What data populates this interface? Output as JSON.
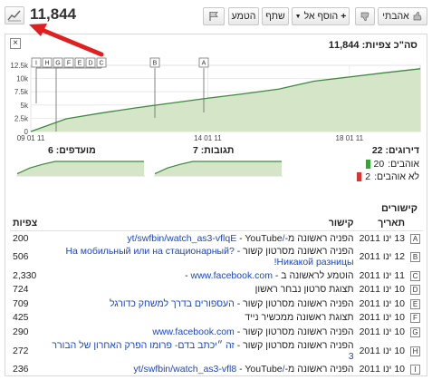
{
  "header": {
    "view_count": "11,844",
    "like_label": "אהבתי",
    "add_to_label": "הוסף אל",
    "share_label": "שתף",
    "embed_label": "הטמע"
  },
  "stats": {
    "total_views_label": "סה\"כ צפיות:",
    "total_views_value": "11,844",
    "ratings_label": "דירוגים:",
    "ratings_value": "22",
    "comments_label": "תגובות:",
    "comments_value": "7",
    "favorites_label": "מועדפים:",
    "favorites_value": "6",
    "likes_label": "אוהבים:",
    "likes_value": "20",
    "dislikes_label": "לא אוהבים:",
    "dislikes_value": "2"
  },
  "chart_data": {
    "type": "area",
    "x_tick_labels": [
      "09 01 11",
      "14 01 11",
      "18 01 11"
    ],
    "y_tick_labels": [
      "0",
      "2.5k",
      "5k",
      "7.5k",
      "10k",
      "12.5k"
    ],
    "ylim": [
      0,
      12500
    ],
    "x": [
      0,
      1,
      2,
      3,
      4,
      5,
      6,
      7,
      8,
      9,
      10,
      11
    ],
    "values": [
      0,
      2400,
      3500,
      4500,
      5400,
      6300,
      7100,
      8000,
      9500,
      10300,
      11100,
      11844
    ],
    "annotations": [
      "I",
      "H",
      "G",
      "F",
      "E",
      "D",
      "C",
      "B",
      "A"
    ],
    "grid": true,
    "colors": {
      "fill": "#d5e5c8",
      "line": "#3d8a3d"
    }
  },
  "mini_chart_values": [
    0.15,
    0.55,
    0.8,
    1.0,
    1.0,
    1.0,
    1.0,
    1.0,
    1.0,
    1.0,
    1.0
  ],
  "links_section": {
    "title": "קישורים",
    "col_date": "תאריך",
    "col_link": "קישור",
    "col_views": "צפיות",
    "rows": [
      {
        "letter": "A",
        "date": "13 ינו 2011",
        "desc": "הפניה ראשונה מ-",
        "url": "/yt/swfbin/watch_as3-vflqE",
        "suffix": " - YouTube",
        "views": "200"
      },
      {
        "letter": "B",
        "date": "12 ינו 2011",
        "desc": "הפניה ראשונה מסרטון קשור - ",
        "url": "На мобильный или на стационарный? Никакой разницы!",
        "suffix": "",
        "views": "506"
      },
      {
        "letter": "C",
        "date": "11 ינו 2011",
        "desc": "הוטמע לראשונה ב - ",
        "url": "www.facebook.com",
        "suffix": " - ",
        "views": "2,330"
      },
      {
        "letter": "D",
        "date": "10 ינו 2011",
        "desc": "תצוגת סרטון נבחר ראשון",
        "url": "",
        "suffix": "",
        "views": "724"
      },
      {
        "letter": "E",
        "date": "10 ינו 2011",
        "desc": "הפניה ראשונה מסרטון קשור - ",
        "url": "העספורים בדרך למשחק כדורגל",
        "suffix": "",
        "views": "709"
      },
      {
        "letter": "F",
        "date": "10 ינו 2011",
        "desc": "תצוגת ראשונה ממכשיר נייד",
        "url": "",
        "suffix": "",
        "views": "425"
      },
      {
        "letter": "G",
        "date": "10 ינו 2011",
        "desc": "הפניה ראשונה מסרטון קשור - ",
        "url": "www.facebook.com",
        "suffix": "",
        "views": "290"
      },
      {
        "letter": "H",
        "date": "10 ינו 2011",
        "desc": "הפניה ראשונה מסרטון קשור - ",
        "url": "זה ״יכתב בדם- פרומו הפרק האחרון של הבורר 3",
        "suffix": "",
        "views": "272"
      },
      {
        "letter": "I",
        "date": "10 ינו 2011",
        "desc": "הפניה ראשונה מ-",
        "url": "/yt/swfbin/watch_as3-vfl8",
        "suffix": " - YouTube",
        "views": "236"
      }
    ]
  }
}
